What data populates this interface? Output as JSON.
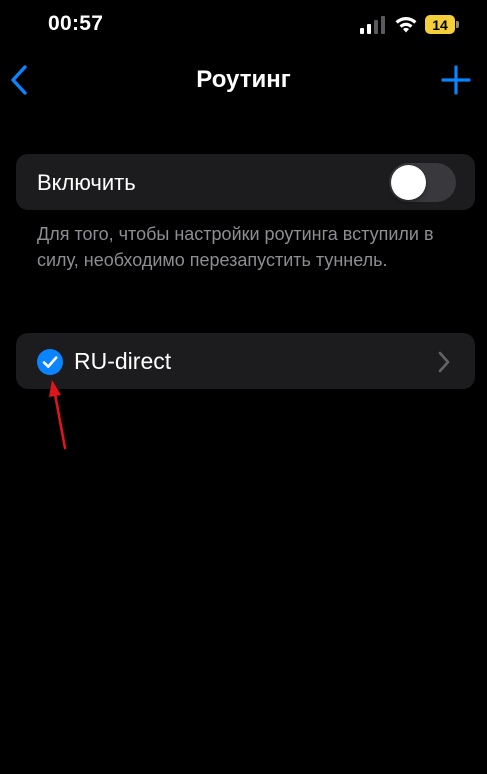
{
  "status_bar": {
    "time": "00:57",
    "battery_level": "14",
    "battery_color": "#f4cf3b"
  },
  "nav": {
    "back_icon": "chevron-left-icon",
    "title": "Роутинг",
    "add_icon": "plus-icon",
    "accent_color": "#0a84ff"
  },
  "toggle": {
    "label": "Включить",
    "state": "off"
  },
  "footnote": "Для того, чтобы настройки роутинга вступили в силу, необходимо перезапустить туннель.",
  "routes": [
    {
      "label": "RU-direct",
      "checked": true,
      "icon": "checkmark-circle-icon"
    }
  ],
  "annotation": {
    "icon": "red-arrow-icon",
    "color": "#e0141b"
  }
}
